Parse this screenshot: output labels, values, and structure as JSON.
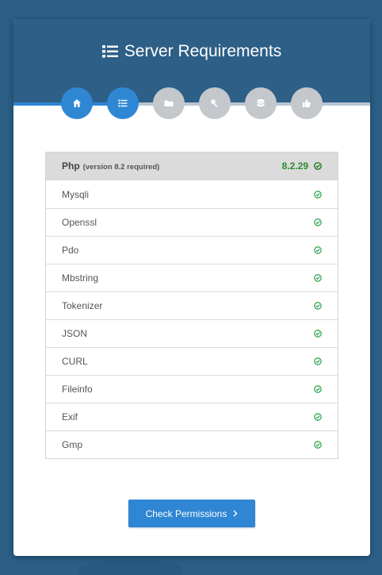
{
  "header": {
    "title": "Server Requirements",
    "title_icon": "list-icon"
  },
  "steps": [
    {
      "icon": "home-icon",
      "state": "active"
    },
    {
      "icon": "list-icon",
      "state": "active"
    },
    {
      "icon": "folder-icon",
      "state": "pending"
    },
    {
      "icon": "key-icon",
      "state": "pending"
    },
    {
      "icon": "database-icon",
      "state": "pending"
    },
    {
      "icon": "thumbs-up-icon",
      "state": "pending"
    }
  ],
  "php": {
    "name": "Php",
    "note": "(version 8.2 required)",
    "version": "8.2.29",
    "status": "ok"
  },
  "requirements": [
    {
      "name": "Mysqli",
      "status": "ok"
    },
    {
      "name": "Openssl",
      "status": "ok"
    },
    {
      "name": "Pdo",
      "status": "ok"
    },
    {
      "name": "Mbstring",
      "status": "ok"
    },
    {
      "name": "Tokenizer",
      "status": "ok"
    },
    {
      "name": "JSON",
      "status": "ok"
    },
    {
      "name": "CURL",
      "status": "ok"
    },
    {
      "name": "Fileinfo",
      "status": "ok"
    },
    {
      "name": "Exif",
      "status": "ok"
    },
    {
      "name": "Gmp",
      "status": "ok"
    }
  ],
  "action": {
    "label": "Check Permissions",
    "icon": "chevron-right-icon"
  },
  "colors": {
    "page_bg": "#2b5f86",
    "header_bg": "#2d5f87",
    "accent": "#2f86d4",
    "step_pending": "#c4c7cb",
    "ok_green": "#2a8a2a"
  }
}
